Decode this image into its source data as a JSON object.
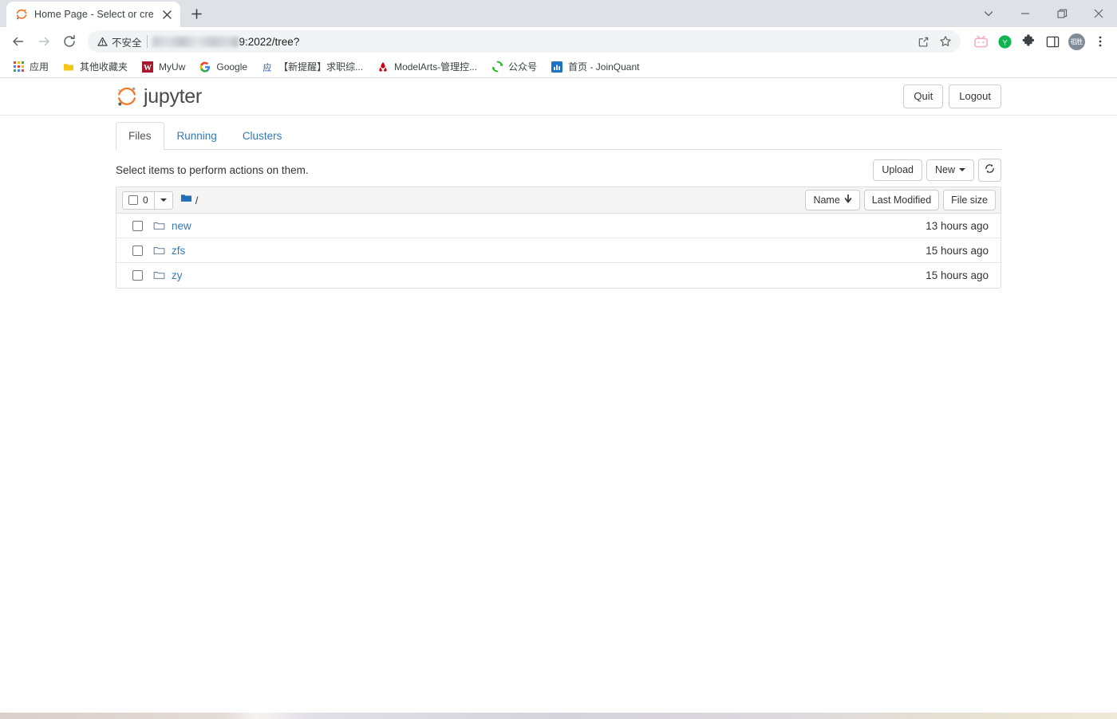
{
  "browser": {
    "tab": {
      "title": "Home Page - Select or create",
      "favicon": "jupyter-favicon",
      "close": "×"
    },
    "newtab_label": "+",
    "window_controls": [
      {
        "name": "tab-search",
        "glyph": "⌄"
      },
      {
        "name": "minimize",
        "glyph": "—"
      },
      {
        "name": "maximize",
        "glyph": "❐"
      },
      {
        "name": "close",
        "glyph": "✕"
      }
    ],
    "nav": {
      "back": "←",
      "forward": "→",
      "reload": "⟳"
    },
    "omnibox": {
      "security_label": "不安全",
      "url_suffix": "9:2022/tree?",
      "share_icon": "share-icon",
      "star_icon": "star-icon"
    },
    "extensions": [
      {
        "name": "bilibili-extension",
        "glyph": ""
      },
      {
        "name": "youdao-extension",
        "glyph": "Y"
      },
      {
        "name": "extensions-puzzle",
        "glyph": ""
      },
      {
        "name": "side-panel",
        "glyph": ""
      },
      {
        "name": "profile-avatar",
        "glyph": "祖胜"
      },
      {
        "name": "chrome-menu",
        "glyph": "⋮"
      }
    ],
    "bookmarks": [
      {
        "label": "应用",
        "icon": "apps-grid-icon"
      },
      {
        "label": "其他收藏夹",
        "icon": "folder-icon"
      },
      {
        "label": "MyUw",
        "icon": "w-icon"
      },
      {
        "label": "Google",
        "icon": "google-icon"
      },
      {
        "label": "【新提醒】求职综...",
        "icon": "baidu-icon"
      },
      {
        "label": "ModelArts-管理控...",
        "icon": "huawei-icon"
      },
      {
        "label": "公众号",
        "icon": "wechat-icon"
      },
      {
        "label": "首页 - JoinQuant",
        "icon": "joinquant-icon"
      }
    ]
  },
  "jupyter": {
    "logo_text": "jupyter",
    "header_buttons": [
      {
        "label": "Quit",
        "name": "quit-button"
      },
      {
        "label": "Logout",
        "name": "logout-button"
      }
    ],
    "tabs": [
      {
        "label": "Files",
        "active": true
      },
      {
        "label": "Running",
        "active": false
      },
      {
        "label": "Clusters",
        "active": false
      }
    ],
    "actions_note": "Select items to perform actions on them.",
    "toolbar": {
      "upload_label": "Upload",
      "new_label": "New",
      "refresh_icon": "refresh-icon"
    },
    "list_header": {
      "selected_count": "0",
      "breadcrumb_root": "/",
      "sort_buttons": [
        {
          "label": "Name",
          "arrow": "↓",
          "name": "sort-name-button"
        },
        {
          "label": "Last Modified",
          "arrow": "",
          "name": "sort-last-modified-button"
        },
        {
          "label": "File size",
          "arrow": "",
          "name": "sort-file-size-button"
        }
      ]
    },
    "files": [
      {
        "name": "new",
        "modified": "13 hours ago",
        "type": "folder"
      },
      {
        "name": "zfs",
        "modified": "15 hours ago",
        "type": "folder"
      },
      {
        "name": "zy",
        "modified": "15 hours ago",
        "type": "folder"
      }
    ]
  },
  "colors": {
    "jupyter_orange": "#f37726",
    "link_blue": "#337ab7",
    "folder_blue": "#1f6fb5",
    "chrome_tabstrip": "#dee1e6"
  }
}
